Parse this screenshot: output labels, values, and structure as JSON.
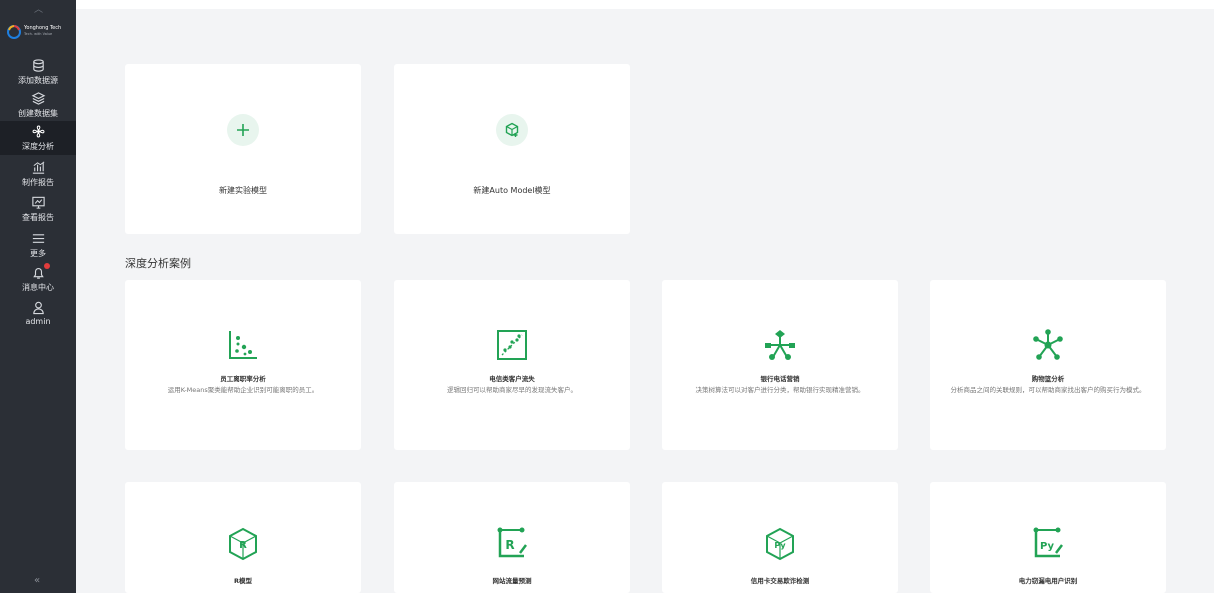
{
  "brand": {
    "name": "Yonghong Tech",
    "sub": "Tech. with Value"
  },
  "accent": "#22a355",
  "sidebar": {
    "items": [
      {
        "label": "添加数据源",
        "icon": "database-icon"
      },
      {
        "label": "创建数据集",
        "icon": "layers-icon"
      },
      {
        "label": "深度分析",
        "icon": "fan-icon"
      },
      {
        "label": "制作报告",
        "icon": "report-chart-icon"
      },
      {
        "label": "查看报告",
        "icon": "monitor-icon"
      },
      {
        "label": "更多",
        "icon": "menu-icon"
      },
      {
        "label": "消息中心",
        "icon": "bell-icon"
      },
      {
        "label": "admin",
        "icon": "user-icon"
      }
    ],
    "collapse_glyph": "«"
  },
  "new_models": [
    {
      "title": "新建实验模型",
      "icon": "plus-icon"
    },
    {
      "title": "新建Auto Model模型",
      "icon": "cube-plus-icon"
    }
  ],
  "section_title": "深度分析案例",
  "cases_row1": [
    {
      "title": "员工离职率分析",
      "desc": "运用K-Means聚类能帮助企业识别可能离职的员工。",
      "icon": "scatter-plot-icon"
    },
    {
      "title": "电信类客户流失",
      "desc": "逻辑回归可以帮助商家尽早的发现流失客户。",
      "icon": "regression-chart-icon"
    },
    {
      "title": "银行电话营销",
      "desc": "决策树算法可以对客户进行分类，帮助银行实现精准营销。",
      "icon": "decision-tree-icon"
    },
    {
      "title": "购物篮分析",
      "desc": "分析商品之间的关联规则，可以帮助商家找出客户的购买行为模式。",
      "icon": "network-star-icon"
    }
  ],
  "cases_row2": [
    {
      "title": "R模型",
      "icon": "r-cube-icon"
    },
    {
      "title": "网站流量预测",
      "icon": "r-script-icon"
    },
    {
      "title": "信用卡交易欺诈检测",
      "icon": "py-cube-icon"
    },
    {
      "title": "电力窃漏电用户识别",
      "icon": "py-script-icon"
    }
  ]
}
